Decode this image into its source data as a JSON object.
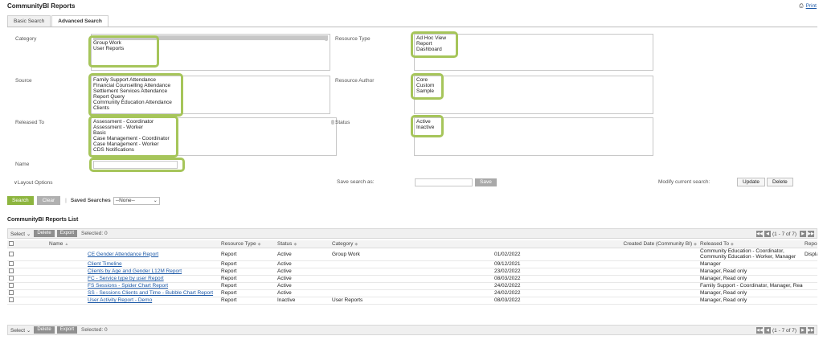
{
  "page": {
    "title": "CommunityBI Reports",
    "print_label": "Print",
    "print_icon": "printer-icon"
  },
  "tabs": [
    {
      "label": "Basic Search",
      "active": false
    },
    {
      "label": "Advanced Search",
      "active": true
    }
  ],
  "filters": {
    "category": {
      "label": "Category",
      "options": [
        "",
        "Group Work",
        "User Reports"
      ]
    },
    "resource_type": {
      "label": "Resource Type",
      "options": [
        "Ad Hoc View",
        "Report",
        "Dashboard"
      ]
    },
    "source": {
      "label": "Source",
      "options": [
        "Family Support Attendance",
        "Financial Counselling Attendance",
        "Settlement Services Attendance",
        "Report Query",
        "Community Education Attendance",
        "Clients"
      ]
    },
    "resource_author": {
      "label": "Resource Author",
      "options": [
        "Core",
        "Custom",
        "Sample"
      ]
    },
    "released_to": {
      "label": "Released To",
      "options": [
        "Assessment - Coordinator",
        "Assessment - Worker",
        "Basic",
        "Case Management - Coordinator",
        "Case Management - Worker",
        "CDS Notifications"
      ]
    },
    "status": {
      "label": "Status",
      "options": [
        "Active",
        "Inactive"
      ]
    },
    "name": {
      "label": "Name",
      "value": ""
    },
    "layout_options": "Layout Options",
    "save_search_label": "Save search as:",
    "save_search_value": "",
    "save_button": "Save",
    "modify_label": "Modify current search:",
    "update_button": "Update",
    "delete_button": "Delete"
  },
  "actions": {
    "search": "Search",
    "clear": "Clear",
    "separator": "|",
    "saved_searches_label": "Saved Searches",
    "saved_searches_value": "--None--"
  },
  "list": {
    "title": "CommunityBI Reports List",
    "toolbar": {
      "select_label": "Select",
      "delete": "Delete",
      "export": "Export",
      "selected": "Selected: 0",
      "page_info": "(1 - 7 of 7)"
    },
    "columns": [
      "Name",
      "Resource Type",
      "Status",
      "Category",
      "Created Date (Community BI)",
      "Released To",
      "Report Purpose"
    ],
    "rows": [
      {
        "name": "CE Gender Attendance Report",
        "type": "Report",
        "status": "Active",
        "category": "Group Work",
        "created": "01/02/2022",
        "released": "Community Education - Coordinator, Community Education - Worker, Manager",
        "purpose": "Display Gender Attendance Report for CE in Graph form"
      },
      {
        "name": "Client Timeline",
        "type": "Report",
        "status": "Active",
        "category": "",
        "created": "09/12/2021",
        "released": "Manager",
        "purpose": ""
      },
      {
        "name": "Clients by Age and Gender L12M Report",
        "type": "Report",
        "status": "Active",
        "category": "",
        "created": "23/02/2022",
        "released": "Manager, Read only",
        "purpose": ""
      },
      {
        "name": "FC - Service type by user Report",
        "type": "Report",
        "status": "Active",
        "category": "",
        "created": "08/03/2022",
        "released": "Manager, Read only",
        "purpose": ""
      },
      {
        "name": "FS Sessions - Spider Chart Report",
        "type": "Report",
        "status": "Active",
        "category": "",
        "created": "24/02/2022",
        "released": "Family Support - Coordinator, Manager, Read only",
        "purpose": ""
      },
      {
        "name": "SS - Sessions Clients and Time - Bubble Chart Report",
        "type": "Report",
        "status": "Active",
        "category": "",
        "created": "24/02/2022",
        "released": "Manager, Read only",
        "purpose": ""
      },
      {
        "name": "User Activity Report - Demo",
        "type": "Report",
        "status": "Inactive",
        "category": "User Reports",
        "created": "08/03/2022",
        "released": "Manager, Read only",
        "purpose": ""
      }
    ]
  },
  "colors": {
    "accent_green": "#8db53f",
    "highlight_ring": "#a6c55a",
    "link": "#1a57a6"
  }
}
